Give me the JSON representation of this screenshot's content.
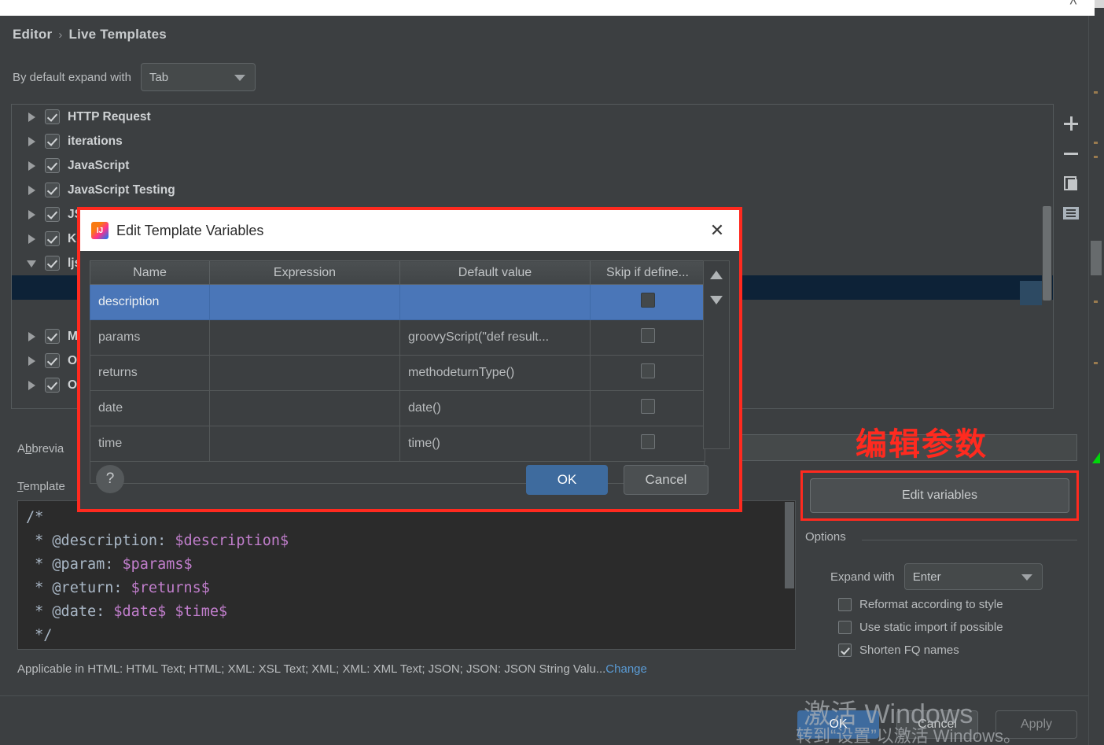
{
  "window": {
    "close_icon": "close-icon",
    "top_chevron": "chevron-up-icon"
  },
  "breadcrumb": {
    "root": "Editor",
    "separator": "›",
    "current": "Live Templates"
  },
  "expand_default": {
    "label": "By default expand with",
    "value": "Tab",
    "caret_icon": "chevron-down-icon"
  },
  "tree": {
    "items": [
      {
        "label": "HTTP Request",
        "expander": "right",
        "checked": true,
        "selected": false,
        "child": false
      },
      {
        "label": "iterations",
        "expander": "right",
        "checked": true,
        "selected": false,
        "child": false
      },
      {
        "label": "JavaScript",
        "expander": "right",
        "checked": true,
        "selected": false,
        "child": false
      },
      {
        "label": "JavaScript Testing",
        "expander": "right",
        "checked": true,
        "selected": false,
        "child": false
      },
      {
        "label": "JSP",
        "expander": "right",
        "checked": true,
        "selected": false,
        "child": false
      },
      {
        "label": "Ko",
        "expander": "right",
        "checked": true,
        "selected": false,
        "child": false
      },
      {
        "label": "ljs",
        "expander": "down",
        "checked": true,
        "selected": false,
        "child": false
      },
      {
        "label": "",
        "expander": "none",
        "checked": true,
        "selected": true,
        "child": true
      },
      {
        "label": "",
        "expander": "none",
        "checked": true,
        "selected": false,
        "child": true
      },
      {
        "label": "Ma",
        "expander": "right",
        "checked": true,
        "selected": false,
        "child": false
      },
      {
        "label": "OC",
        "expander": "right",
        "checked": true,
        "selected": false,
        "child": false
      },
      {
        "label": "OC",
        "expander": "right",
        "checked": true,
        "selected": false,
        "child": false
      }
    ]
  },
  "side_toolbar": {
    "buttons": [
      {
        "icon": "plus-icon",
        "name": "add-template-button"
      },
      {
        "icon": "minus-icon",
        "name": "remove-template-button"
      },
      {
        "icon": "copy-icon",
        "name": "duplicate-template-button"
      },
      {
        "icon": "list-icon",
        "name": "change-context-button"
      }
    ]
  },
  "form": {
    "abbreviation_label": "Abbreviation:",
    "abbreviation_value": "",
    "template_label": "Template text:",
    "template_lines": [
      {
        "prefix": "/*",
        "var": "",
        "suffix": ""
      },
      {
        "prefix": " * @description: ",
        "var": "$description$",
        "suffix": ""
      },
      {
        "prefix": " * @param: ",
        "var": "$params$",
        "suffix": ""
      },
      {
        "prefix": " * @return: ",
        "var": "$returns$",
        "suffix": ""
      },
      {
        "prefix": " * @date: ",
        "var": "$date$ $time$",
        "suffix": ""
      },
      {
        "prefix": " */",
        "var": "",
        "suffix": ""
      }
    ],
    "applicable_text": "Applicable in HTML: HTML Text; HTML; XML: XSL Text; XML; XML: XML Text; JSON; JSON: JSON String Valu...",
    "applicable_change_link": "Change"
  },
  "options_pane": {
    "annotation_cn": "编辑参数",
    "edit_variables_button": "Edit variables",
    "legend": "Options",
    "expand_with_label": "Expand with",
    "expand_with_value": "Enter",
    "caret_icon": "chevron-down-icon",
    "checkboxes": [
      {
        "label": "Reformat according to style",
        "checked": false
      },
      {
        "label": "Use static import if possible",
        "checked": false
      },
      {
        "label": "Shorten FQ names",
        "checked": true
      }
    ]
  },
  "bottom_bar": {
    "ok": "OK",
    "cancel": "Cancel",
    "apply": "Apply"
  },
  "watermark": {
    "line1": "激活 Windows",
    "line2": "转到“设置”以激活 Windows。"
  },
  "dialog": {
    "title": "Edit Template Variables",
    "app_icon": "intellij-icon",
    "close_icon": "close-icon",
    "columns": [
      "Name",
      "Expression",
      "Default value",
      "Skip if define..."
    ],
    "rows": [
      {
        "name": "description",
        "expression": "",
        "default_value": "",
        "skip": false,
        "selected": true
      },
      {
        "name": "params",
        "expression": "",
        "default_value": "groovyScript(\"def result...",
        "skip": false,
        "selected": false
      },
      {
        "name": "returns",
        "expression": "",
        "default_value": "methodeturnType()",
        "skip": false,
        "selected": false
      },
      {
        "name": "date",
        "expression": "",
        "default_value": "date()",
        "skip": false,
        "selected": false
      },
      {
        "name": "time",
        "expression": "",
        "default_value": "time()",
        "skip": false,
        "selected": false
      }
    ],
    "scroll_up_icon": "triangle-up-icon",
    "scroll_down_icon": "triangle-down-icon",
    "help_label": "?",
    "ok": "OK",
    "cancel": "Cancel"
  },
  "colors": {
    "background": "#3c3f41",
    "selection_blue": "#4a76b8",
    "accent_red": "#ff2a1f",
    "link_blue": "#5a9bd5",
    "variable_purple": "#c17ecc",
    "tree_selected": "#0d2237"
  }
}
